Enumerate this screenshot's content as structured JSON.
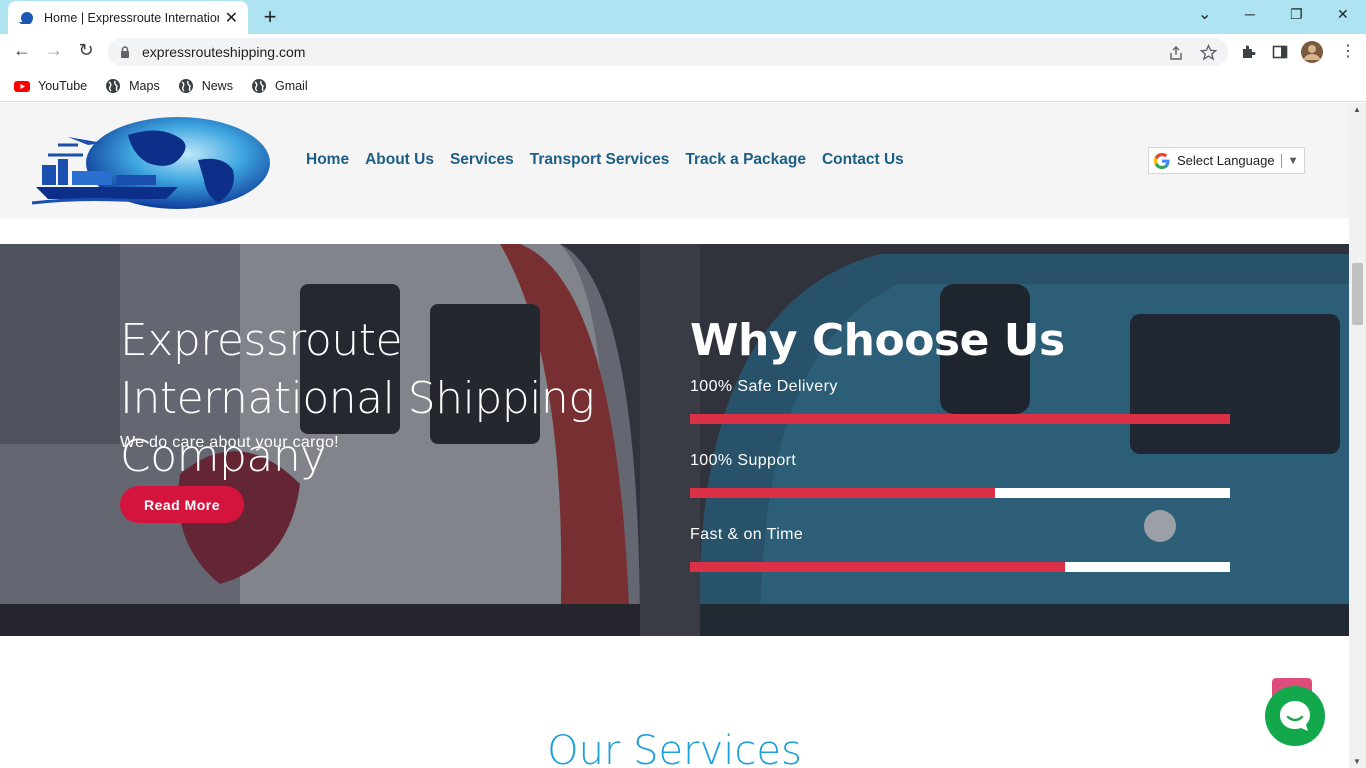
{
  "browser": {
    "tab_title": "Home | Expressroute International Shipping",
    "url": "expressrouteshipping.com",
    "new_tab": "+",
    "tab_close": "✕",
    "window_controls": {
      "minimize": "─",
      "maximize": "❐",
      "close": "✕",
      "tab_search": "⌄"
    },
    "nav": {
      "back": "←",
      "forward": "→",
      "reload": "↻"
    },
    "bookmarks": [
      {
        "label": "YouTube",
        "icon": "youtube-icon"
      },
      {
        "label": "Maps",
        "icon": "globe-icon"
      },
      {
        "label": "News",
        "icon": "globe-icon"
      },
      {
        "label": "Gmail",
        "icon": "globe-icon"
      }
    ]
  },
  "header": {
    "nav": [
      "Home",
      "About Us",
      "Services",
      "Transport Services",
      "Track a Package",
      "Contact Us"
    ],
    "language": {
      "label": "Select Language",
      "caret": "▼"
    }
  },
  "hero": {
    "title": "Expressroute International Shipping Company",
    "subtitle": "We do care about your cargo!",
    "cta": "Read More",
    "why_title": "Why Choose Us",
    "skills": [
      {
        "label": "100% Safe Delivery",
        "value": 100
      },
      {
        "label": "100% Support",
        "value": 56.5
      },
      {
        "label": "Fast & on Time",
        "value": 69.5
      }
    ]
  },
  "services": {
    "heading": "Our Services"
  },
  "colors": {
    "accent": "#db3045",
    "nav": "#1d5e85",
    "heading": "#1ea0d8",
    "chat": "#13a84b"
  }
}
